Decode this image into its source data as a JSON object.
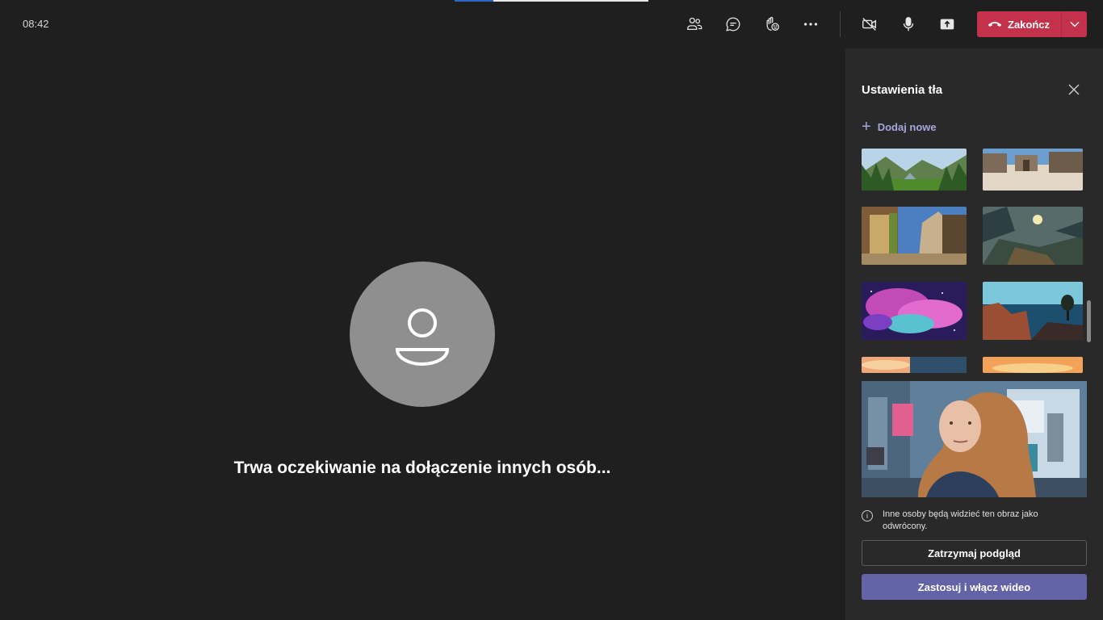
{
  "header": {
    "time": "08:42",
    "progress_fraction": 0.2,
    "buttons": [
      {
        "name": "participants",
        "icon": "people-icon"
      },
      {
        "name": "chat",
        "icon": "chat-icon"
      },
      {
        "name": "reactions",
        "icon": "raise-hand-icon"
      },
      {
        "name": "more",
        "icon": "more-icon"
      },
      {
        "name": "camera",
        "icon": "camera-off-icon"
      },
      {
        "name": "mic",
        "icon": "microphone-icon"
      },
      {
        "name": "share",
        "icon": "share-screen-icon"
      }
    ],
    "end_call_label": "Zakończ",
    "end_call_color": "#c4314b"
  },
  "stage": {
    "waiting_text": "Trwa oczekiwanie na dołączenie innych osób..."
  },
  "panel": {
    "title": "Ustawienia tła",
    "add_new_label": "Dodaj nowe",
    "backgrounds": [
      {
        "name": "mountain-valley"
      },
      {
        "name": "desert-town"
      },
      {
        "name": "fantasy-village"
      },
      {
        "name": "alien-planet"
      },
      {
        "name": "nebula"
      },
      {
        "name": "coastal-cliffs"
      },
      {
        "name": "sunset-sky-1"
      },
      {
        "name": "sunset-sky-2"
      }
    ],
    "note": "Inne osoby będą widzieć ten obraz jako odwrócony.",
    "stop_preview_label": "Zatrzymaj podgląd",
    "apply_label": "Zastosuj i włącz wideo",
    "accent_color": "#6264a7"
  }
}
